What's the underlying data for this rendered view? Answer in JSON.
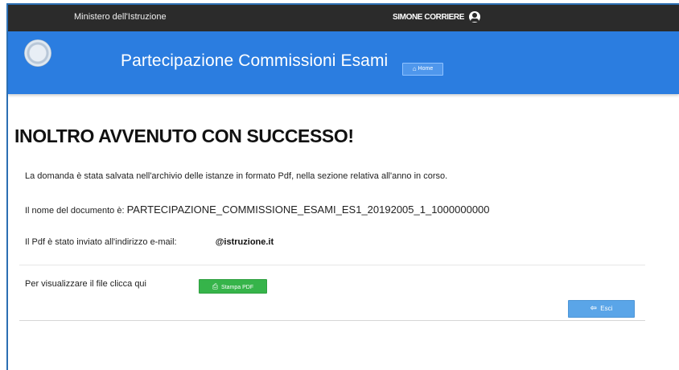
{
  "topbar": {
    "ministry_name": "Ministero dell'Istruzione",
    "user_name": "SIMONE CORRIERE"
  },
  "appbar": {
    "title": "Partecipazione Commissioni Esami",
    "home_button": "Home"
  },
  "main": {
    "headline": "INOLTRO AVVENUTO CON SUCCESSO!",
    "saved_message": "La domanda è stata salvata nell'archivio delle istanze in formato Pdf, nella sezione relativa all'anno in corso.",
    "document_label": "Il nome del documento è:",
    "document_name": "PARTECIPAZIONE_COMMISSIONE_ESAMI_ES1_20192005_1_1000000000",
    "email_label": "Il Pdf è stato inviato all'indirizzo e-mail:",
    "email_domain": "@istruzione.it",
    "view_label": "Per visualizzare il file clicca qui",
    "pdf_button": "Stampa PDF",
    "exit_button": "Esci"
  }
}
